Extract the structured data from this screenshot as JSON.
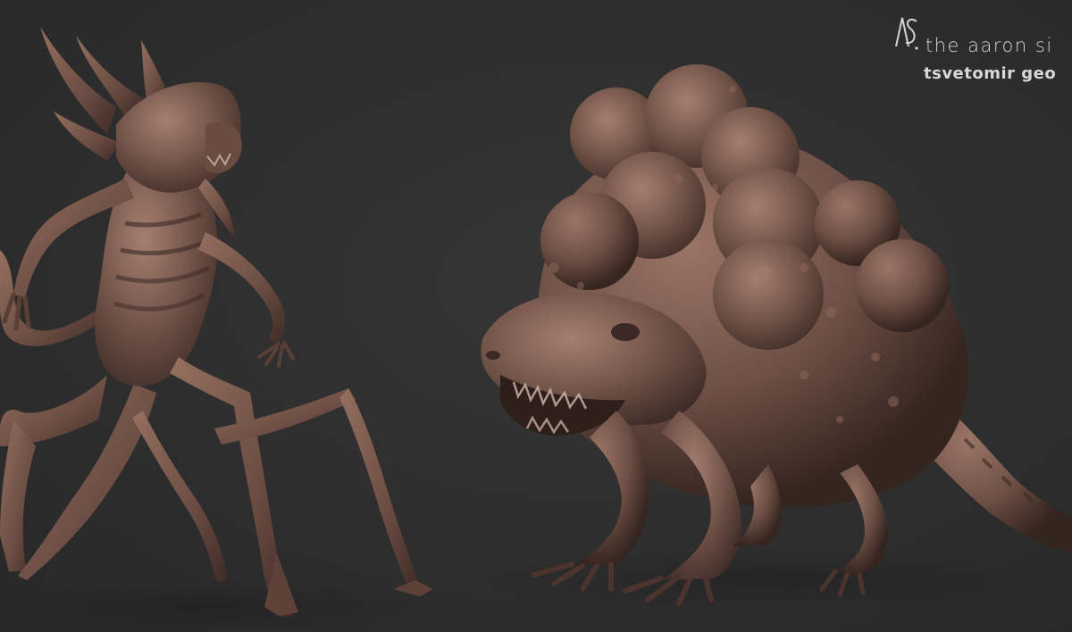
{
  "watermark": {
    "logo_text": "AS",
    "line1": "the aaron si",
    "line2": "tsvetomir geo"
  },
  "colors": {
    "background": "#2f2f2f",
    "sculpt_clay": "#7a5a4e",
    "sculpt_shadow": "#3a2925",
    "sculpt_highlight": "#a07d6e",
    "watermark_text": "#d6d6d6"
  }
}
